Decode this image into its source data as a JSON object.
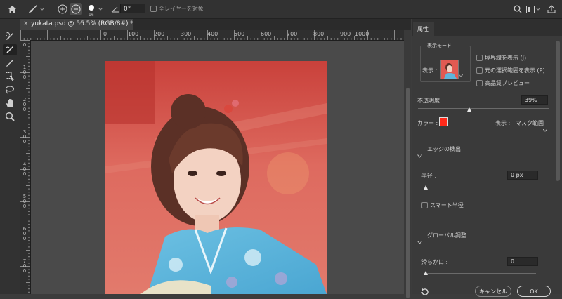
{
  "toolbar": {
    "brush_size": "16",
    "angle_value": "0°",
    "sample_all_layers_label": "全レイヤーを対象"
  },
  "document": {
    "tab_title": "yukata.psd @ 56.5% (RGB/8#) *",
    "close_glyph": "×"
  },
  "rulers": {
    "horizontal": [
      "0",
      "100",
      "200",
      "300",
      "400",
      "500",
      "600",
      "700",
      "800",
      "900",
      "1000"
    ],
    "vertical": [
      [
        "0"
      ],
      [
        "1",
        "0",
        "0"
      ],
      [
        "2",
        "0",
        "0"
      ],
      [
        "3",
        "0",
        "0"
      ],
      [
        "4",
        "0",
        "0"
      ],
      [
        "5",
        "0",
        "0"
      ],
      [
        "6",
        "0",
        "0"
      ],
      [
        "7",
        "0",
        "0"
      ]
    ]
  },
  "properties": {
    "panel_title": "属性",
    "view_mode_section": "表示モード",
    "view_label": "表示 :",
    "show_edge_label": "境界線を表示 (J)",
    "show_original_label": "元の選択範囲を表示 (P)",
    "high_quality_label": "高品質プレビュー",
    "opacity_label": "不透明度 :",
    "opacity_value": "39%",
    "opacity_fraction": 0.39,
    "color_label": "カラー :",
    "color_swatch": "#ff2a1a",
    "display_label": "表示 :",
    "display_value": "マスク範囲",
    "edge_detection_section": "エッジの検出",
    "radius_label": "半径 :",
    "radius_value": "0 px",
    "smart_radius_label": "スマート半径",
    "global_refine_section": "グローバル調整",
    "smooth_label": "滑らかに :",
    "smooth_value": "0",
    "cancel_label": "キャンセル",
    "ok_label": "OK"
  },
  "colors": {
    "overlay_red": "#e8463e",
    "kimono_blue": "#5fb6dc",
    "accent_red": "#ff2a1a"
  }
}
